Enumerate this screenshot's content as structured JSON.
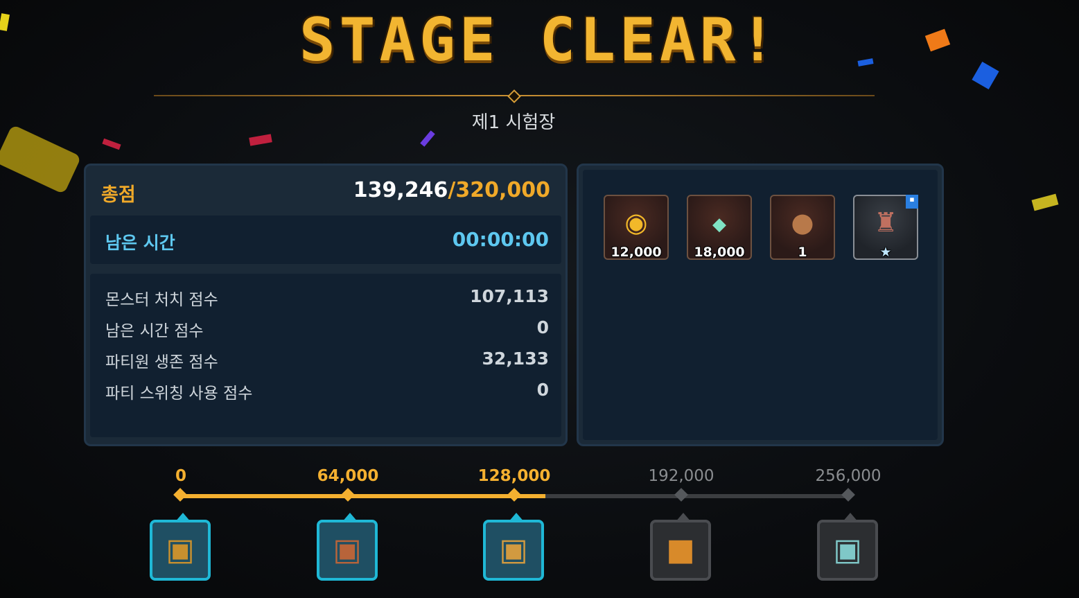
{
  "title": "STAGE CLEAR!",
  "stage_name": "제1 시험장",
  "score": {
    "total_label": "총점",
    "total_current": "139,246",
    "total_separator": "/",
    "total_max": "320,000",
    "time_label": "남은 시간",
    "time_value": "00:00:00",
    "details": [
      {
        "label": "몬스터 처치 점수",
        "value": "107,113"
      },
      {
        "label": "남은 시간 점수",
        "value": "0"
      },
      {
        "label": "파티원 생존 점수",
        "value": "32,133"
      },
      {
        "label": "파티 스위칭 사용 점수",
        "value": "0"
      }
    ]
  },
  "rewards": [
    {
      "icon": "gold-coin-icon",
      "count": "12,000"
    },
    {
      "icon": "crystal-icon",
      "count": "18,000"
    },
    {
      "icon": "pouch-icon",
      "count": "1"
    },
    {
      "icon": "trophy-cup-icon",
      "count": ""
    }
  ],
  "milestones": [
    {
      "value": "0",
      "reached": true,
      "icon": "small-chest-icon"
    },
    {
      "value": "64,000",
      "reached": true,
      "icon": "treasure-chest-icon"
    },
    {
      "value": "128,000",
      "reached": true,
      "icon": "large-treasure-chest-icon"
    },
    {
      "value": "192,000",
      "reached": false,
      "icon": "golden-box-icon"
    },
    {
      "value": "256,000",
      "reached": false,
      "icon": "silver-chest-icon"
    }
  ],
  "progress_fraction": 0.547,
  "colors": {
    "gold": "#f0a929",
    "cyan": "#5ec8f0",
    "reached": "#f4b030",
    "unreached": "#8a8d90",
    "chest_reached_border": "#1fb8d6",
    "chest_locked_border": "#4a4c50"
  }
}
